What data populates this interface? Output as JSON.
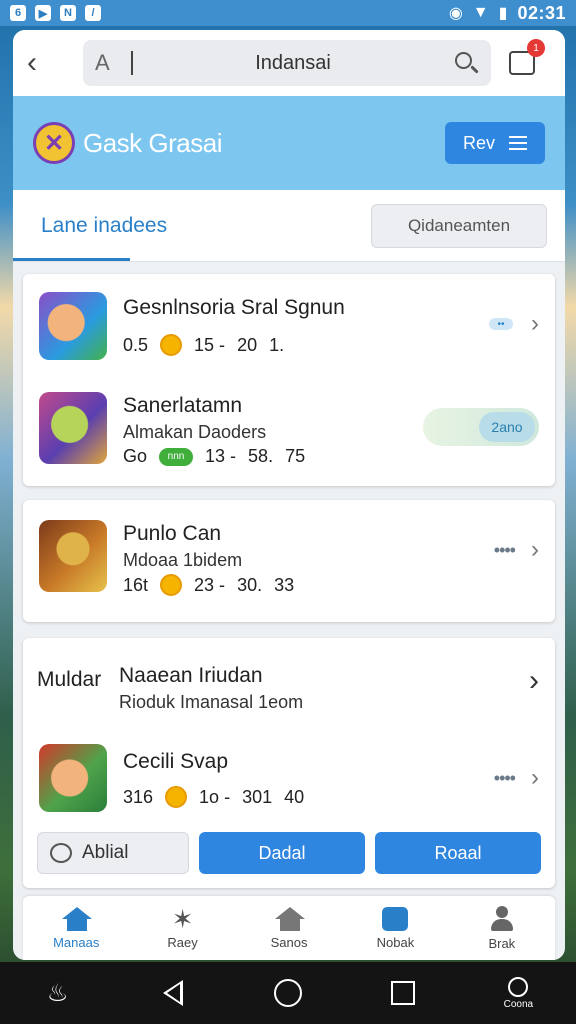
{
  "status_bar": {
    "time": "02:31",
    "icons": [
      "6",
      "▶",
      "N",
      "/"
    ]
  },
  "topbar": {
    "search_text": "Indansai",
    "font_glyph": "A",
    "cart_badge": "1"
  },
  "app_header": {
    "title": "Gask Grasai",
    "button_label": "Rev"
  },
  "tabs": {
    "active": "Lane inadees",
    "button": "Qidaneamten"
  },
  "cards": [
    {
      "title": "Gesnlnsoria Sral Sgnun",
      "meta": [
        "0.5",
        "15 -",
        "20",
        "1."
      ]
    },
    {
      "title": "Sanerlatamn",
      "subtitle": "Almakan Daoders",
      "meta": [
        "Go",
        "13 -",
        "58.",
        "75"
      ],
      "badge": "nnn",
      "toggle_label": "2ano"
    },
    {
      "title": "Punlo Can",
      "subtitle": "Mdoaa 1bidem",
      "meta": [
        "16t",
        "23 -",
        "30.",
        "33"
      ]
    },
    {
      "left_label": "Muldar",
      "title": "Naaean Iriudan",
      "subtitle": "Rioduk Imanasal 1eom"
    },
    {
      "title": "Cecili Svap",
      "meta": [
        "316",
        "1o -",
        "301",
        "40"
      ]
    }
  ],
  "actions": {
    "outline_label": "Ablial",
    "primary_label": "Dadal",
    "secondary_label": "Roaal"
  },
  "bottom_nav": [
    "Manaas",
    "Raey",
    "Sanos",
    "Nobak",
    "Brak"
  ],
  "system_nav": {
    "right_label": "Coona"
  },
  "colors": {
    "accent": "#2f86e0",
    "header": "#7dc6ef",
    "status_bar": "#3f8fcf"
  }
}
